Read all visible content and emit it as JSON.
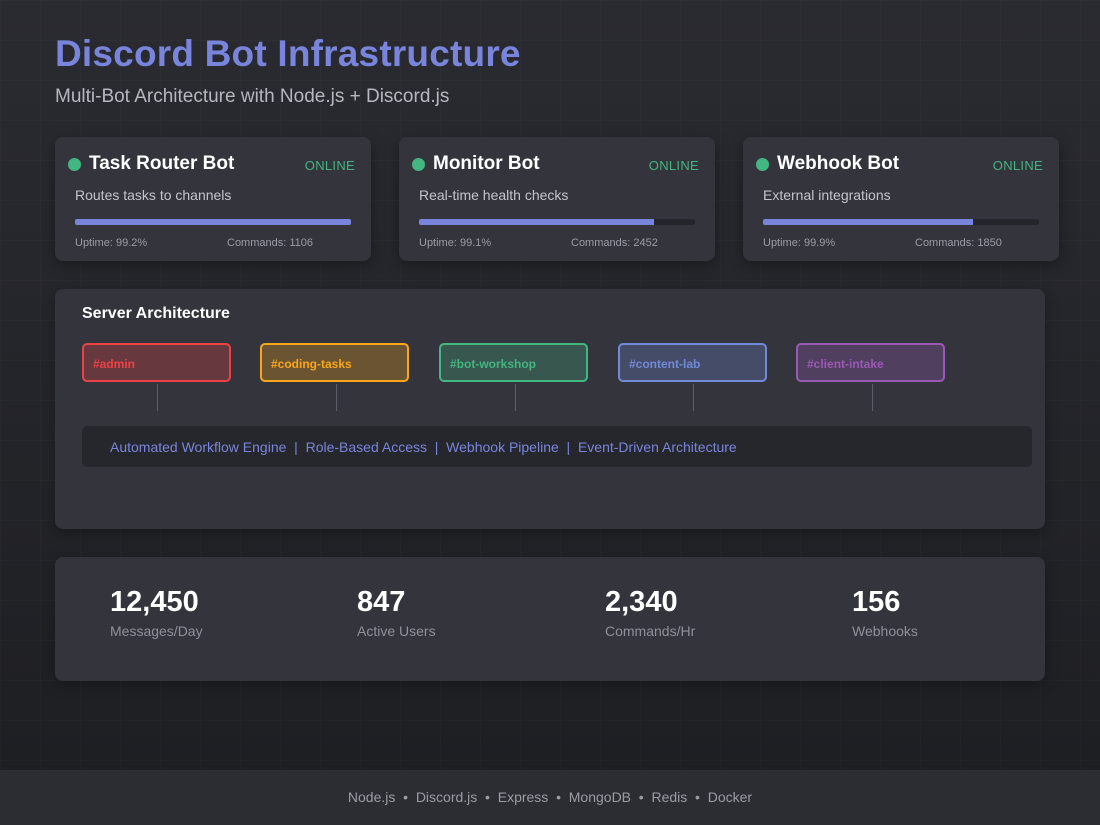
{
  "header": {
    "title": "Discord Bot Infrastructure",
    "subtitle": "Multi-Bot Architecture with Node.js + Discord.js"
  },
  "bots": [
    {
      "name": "Task Router Bot",
      "status": "ONLINE",
      "description": "Routes tasks to channels",
      "load_fraction": 1.0,
      "uptime": "Uptime: 99.2%",
      "commands": "Commands: 1106"
    },
    {
      "name": "Monitor Bot",
      "status": "ONLINE",
      "description": "Real-time health checks",
      "load_fraction": 0.85,
      "uptime": "Uptime: 99.1%",
      "commands": "Commands: 2452"
    },
    {
      "name": "Webhook Bot",
      "status": "ONLINE",
      "description": "External integrations",
      "load_fraction": 0.76,
      "uptime": "Uptime: 99.9%",
      "commands": "Commands: 1850"
    }
  ],
  "architecture": {
    "title": "Server Architecture",
    "channels": [
      {
        "label": "#admin",
        "color": "#ed4245"
      },
      {
        "label": "#coding-tasks",
        "color": "#faa61a"
      },
      {
        "label": "#bot-workshop",
        "color": "#43b581"
      },
      {
        "label": "#content-lab",
        "color": "#7289da"
      },
      {
        "label": "#client-intake",
        "color": "#9b59b6"
      }
    ],
    "features": "Automated Workflow Engine  |  Role-Based Access  |  Webhook Pipeline  |  Event-Driven Architecture"
  },
  "stats": [
    {
      "value": "12,450",
      "label": "Messages/Day"
    },
    {
      "value": "847",
      "label": "Active Users"
    },
    {
      "value": "2,340",
      "label": "Commands/Hr"
    },
    {
      "value": "156",
      "label": "Webhooks"
    }
  ],
  "footer": {
    "tech": "Node.js  •  Discord.js  •  Express  •  MongoDB  •  Redis  •  Docker"
  },
  "colors": {
    "accent": "#7985dc",
    "online": "#43b581"
  }
}
